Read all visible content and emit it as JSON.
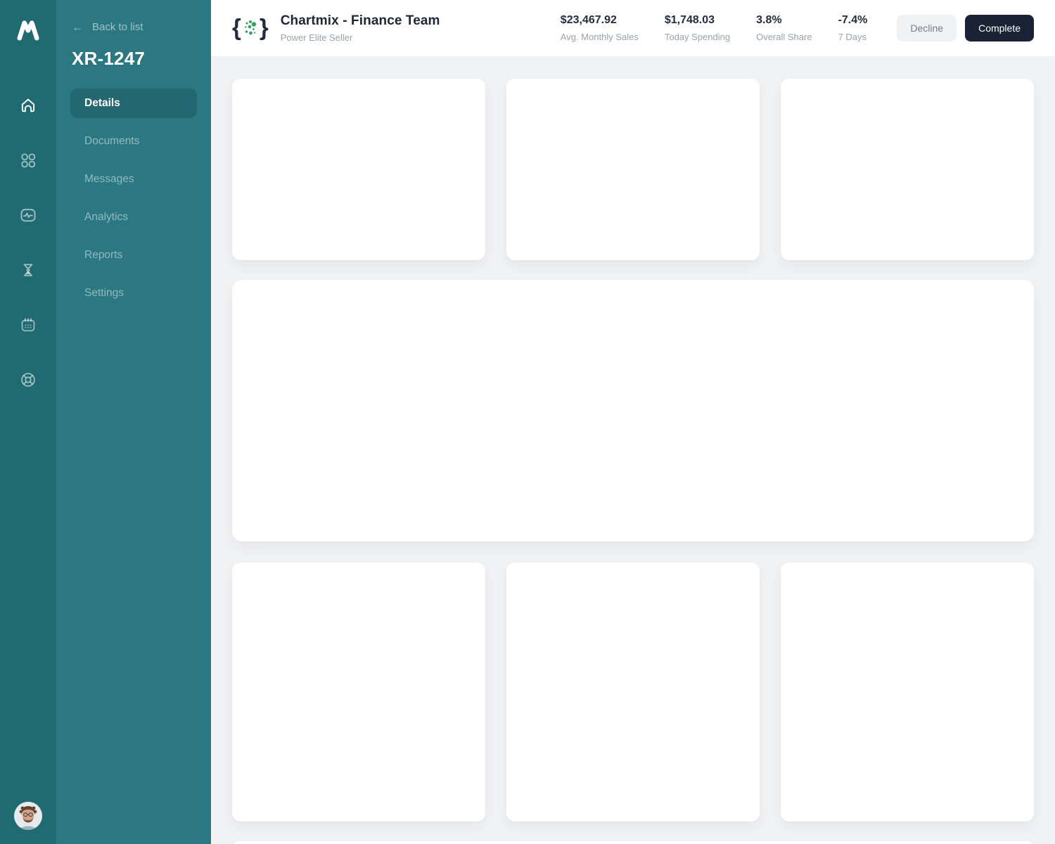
{
  "app": {
    "brand_logo": "m-logo",
    "colors": {
      "rail_bg": "#206a72",
      "sidebar_bg": "#2b7882",
      "accent_green": "#34a165",
      "navy": "#1a2236",
      "content_bg": "#f1f2f4"
    }
  },
  "rail": {
    "items": [
      {
        "icon": "home-icon",
        "active": true
      },
      {
        "icon": "apps-grid-icon",
        "active": false
      },
      {
        "icon": "activity-chart-icon",
        "active": false
      },
      {
        "icon": "hourglass-icon",
        "active": false
      },
      {
        "icon": "calendar-icon",
        "active": false
      },
      {
        "icon": "lifebuoy-help-icon",
        "active": false
      }
    ],
    "avatar": "user-avatar"
  },
  "sidebar": {
    "back_label": "Back to list",
    "record_id": "XR-1247",
    "items": [
      {
        "label": "Details",
        "active": true
      },
      {
        "label": "Documents",
        "active": false
      },
      {
        "label": "Messages",
        "active": false
      },
      {
        "label": "Analytics",
        "active": false
      },
      {
        "label": "Reports",
        "active": false
      },
      {
        "label": "Settings",
        "active": false
      }
    ]
  },
  "header": {
    "company": {
      "title": "Chartmix - Finance Team",
      "subtitle": "Power Elite Seller",
      "logo_icon": "braces-dots-logo-icon",
      "brace_open": "{",
      "brace_close": "}"
    },
    "stats": [
      {
        "value": "$23,467.92",
        "label": "Avg. Monthly Sales"
      },
      {
        "value": "$1,748.03",
        "label": "Today Spending"
      },
      {
        "value": "3.8%",
        "label": "Overall Share"
      },
      {
        "value": "-7.4%",
        "label": "7 Days"
      }
    ],
    "actions": {
      "decline_label": "Decline",
      "complete_label": "Complete"
    }
  },
  "content": {
    "cards": [
      "top-card-1",
      "top-card-2",
      "top-card-3",
      "wide-card",
      "bottom-card-1",
      "bottom-card-2",
      "bottom-card-3",
      "next-row-card-peek"
    ]
  }
}
